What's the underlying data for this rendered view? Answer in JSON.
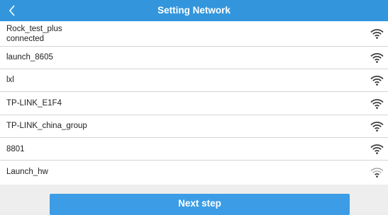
{
  "header": {
    "title": "Setting Network",
    "back_icon": "chevron-left-icon"
  },
  "networks": [
    {
      "name": "Rock_test_plus",
      "status": "connected",
      "signal": 4
    },
    {
      "name": "launch_8605",
      "status": "",
      "signal": 4
    },
    {
      "name": "lxl",
      "status": "",
      "signal": 4
    },
    {
      "name": "TP-LINK_E1F4",
      "status": "",
      "signal": 4
    },
    {
      "name": "TP-LINK_china_group",
      "status": "",
      "signal": 4
    },
    {
      "name": "8801",
      "status": "",
      "signal": 4
    },
    {
      "name": "Launch_hw",
      "status": "",
      "signal": 2
    }
  ],
  "footer": {
    "next_label": "Next step"
  },
  "colors": {
    "header_bg": "#3396dc",
    "button_bg": "#3c9de6",
    "wifi_strong": "#333333",
    "wifi_weak": "#9a9a9a"
  }
}
